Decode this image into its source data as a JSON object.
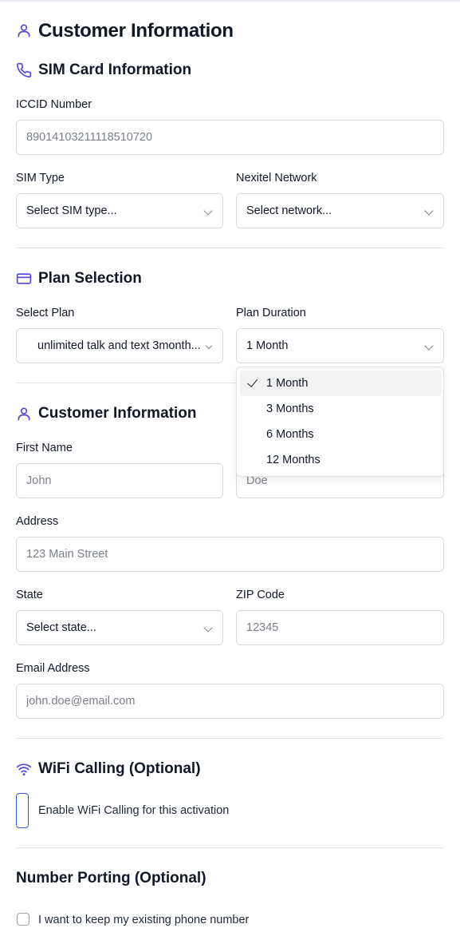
{
  "page": {
    "title": "Customer Information"
  },
  "sim": {
    "title": "SIM Card Information",
    "iccid_label": "ICCID Number",
    "iccid_placeholder": "89014103211118510720",
    "sim_type_label": "SIM Type",
    "sim_type_value": "Select SIM type...",
    "network_label": "Nexitel Network",
    "network_value": "Select network..."
  },
  "plan": {
    "title": "Plan Selection",
    "select_label": "Select Plan",
    "select_value": "unlimited talk and text 3month...",
    "duration_label": "Plan Duration",
    "duration_value": "1 Month",
    "duration_options": [
      "1 Month",
      "3 Months",
      "6 Months",
      "12 Months"
    ],
    "duration_selected": "1 Month"
  },
  "customer": {
    "title": "Customer Information",
    "first_name_label": "First Name",
    "first_name_placeholder": "John",
    "last_name_placeholder": "Doe",
    "address_label": "Address",
    "address_placeholder": "123 Main Street",
    "state_label": "State",
    "state_value": "Select state...",
    "zip_label": "ZIP Code",
    "zip_placeholder": "12345",
    "email_label": "Email Address",
    "email_placeholder": "john.doe@email.com"
  },
  "wifi": {
    "title": "WiFi Calling (Optional)",
    "toggle_label": "Enable WiFi Calling for this activation"
  },
  "porting": {
    "title": "Number Porting (Optional)",
    "checkbox_label": "I want to keep my existing phone number"
  },
  "colors": {
    "accent": "#4f46e5",
    "border": "#d6d9df",
    "toggle_border": "#3b5bdb"
  },
  "icons": [
    "user-icon",
    "phone-icon",
    "credit-card-icon",
    "wifi-icon",
    "chevron-down-icon",
    "check-icon"
  ]
}
